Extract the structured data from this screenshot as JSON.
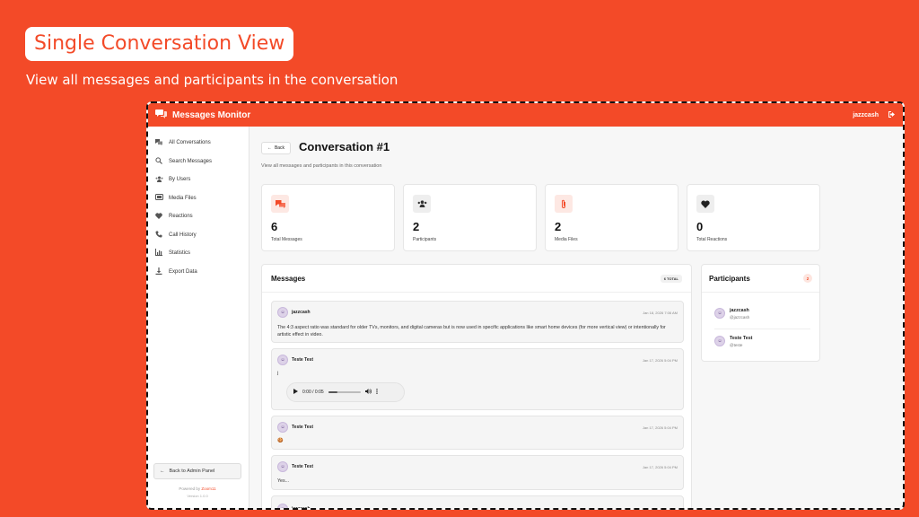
{
  "promo": {
    "title": "Single Conversation View",
    "subtitle": "View all messages and participants in the conversation"
  },
  "app": {
    "name": "Messages Monitor",
    "user": "jazzcash"
  },
  "sidebar": {
    "items": [
      {
        "label": "All Conversations",
        "icon": "chat-bubbles-icon"
      },
      {
        "label": "Search Messages",
        "icon": "search-icon"
      },
      {
        "label": "By Users",
        "icon": "users-icon"
      },
      {
        "label": "Media Files",
        "icon": "media-icon"
      },
      {
        "label": "Reactions",
        "icon": "heart-icon"
      },
      {
        "label": "Call History",
        "icon": "phone-icon"
      },
      {
        "label": "Statistics",
        "icon": "chart-icon"
      },
      {
        "label": "Export Data",
        "icon": "download-icon"
      }
    ],
    "back_admin": "Back to Admin Panel",
    "powered_by": "Powered by",
    "brand": "Zoom11",
    "version": "Version 1.0.0"
  },
  "page": {
    "back_label": "Back",
    "title": "Conversation #1",
    "subtitle": "View all messages and participants in this conversation"
  },
  "stats": [
    {
      "value": "6",
      "label": "Total Messages",
      "icon": "chat-bubbles-icon",
      "color": "#f34a28"
    },
    {
      "value": "2",
      "label": "Participants",
      "icon": "users-icon",
      "color": "#333333"
    },
    {
      "value": "2",
      "label": "Media Files",
      "icon": "paperclip-icon",
      "color": "#f34a28"
    },
    {
      "value": "0",
      "label": "Total Reactions",
      "icon": "heart-icon",
      "color": "#222222"
    }
  ],
  "messages_panel": {
    "title": "Messages",
    "total_badge": "6 TOTAL",
    "messages": [
      {
        "sender": "jazzcash",
        "time": "Jan 18, 2026 7:06 AM",
        "text": "The 4:3 aspect ratio was standard for older TVs, monitors, and digital cameras but is now used in specific applications like smart home devices (for more vertical view) or intentionally for artistic effect in video."
      },
      {
        "sender": "Teste Test",
        "time": "Jan 17, 2026 5:04 PM",
        "text": "j",
        "audio": {
          "time": "0:00 / 0:05",
          "progress": 0.3
        }
      },
      {
        "sender": "Teste Test",
        "time": "Jan 17, 2026 5:04 PM",
        "text": "🍪"
      },
      {
        "sender": "Teste Test",
        "time": "Jan 17, 2026 5:04 PM",
        "text": "Yes..."
      },
      {
        "sender": "jazzcash",
        "time": "",
        "text": ""
      }
    ]
  },
  "participants_panel": {
    "title": "Participants",
    "count": "2",
    "participants": [
      {
        "name": "jazzcash",
        "handle": "@jazzcash"
      },
      {
        "name": "Teste Test",
        "handle": "@teste"
      }
    ]
  }
}
